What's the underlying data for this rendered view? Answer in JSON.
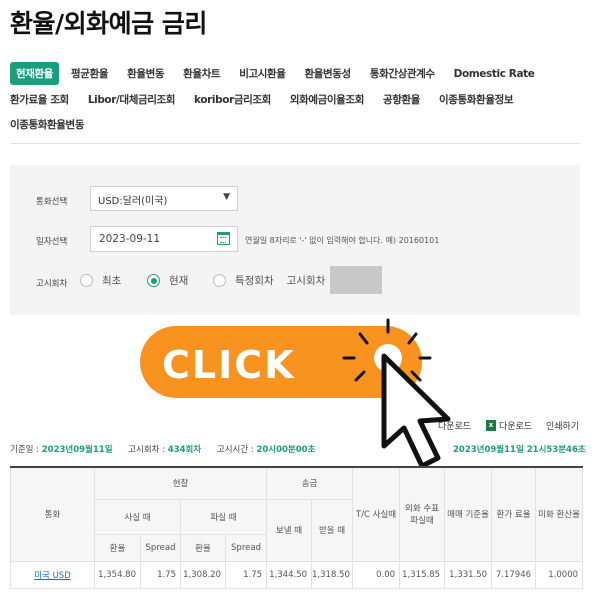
{
  "page": {
    "title": "환율/외화예금 금리"
  },
  "tabs": {
    "row1": [
      "현재환율",
      "평균환율",
      "환율변동",
      "환율차트",
      "비고시환율",
      "환율변동성",
      "통화간상관계수",
      "Domestic Rate"
    ],
    "row2": [
      "환가료율 조회",
      "Libor/대체금리조회",
      "koribor금리조회",
      "외화예금이율조회",
      "공항환율",
      "이종통화환율정보"
    ],
    "row3": [
      "이종통화환율변동"
    ],
    "active": "현재환율"
  },
  "search": {
    "currency_label": "통화선택",
    "currency_value": "USD:달러(미국)",
    "date_label": "일자선택",
    "date_value": "2023-09-11",
    "date_hint": "연월일 8자리로 '-' 없이 입력해야 합니다. 예) 20160101",
    "round_label": "고시회차",
    "round_options": [
      "최초",
      "현재",
      "특정회차"
    ],
    "round_selected": "현재",
    "round_input_label": "고시회차"
  },
  "banner": {
    "text": "CLICK"
  },
  "toolbar": {
    "download1": "다운로드",
    "download2": "다운로드",
    "print": "인쇄하기"
  },
  "info": {
    "base_date_label": "기준일 :",
    "base_date": "2023년09월11일",
    "round_label": "고시회차 :",
    "round": "434회차",
    "time_label": "고시시간 :",
    "time": "20시00분00초",
    "lookup_time": "2023년09월11일 21시53분46초"
  },
  "table": {
    "headers": {
      "currency": "통화",
      "cash": "현찰",
      "remit": "송금",
      "buy": "사실 때",
      "sell": "파실 때",
      "send": "보낼 때",
      "receive": "받을 때",
      "tc": "T/C 사실때",
      "cheque": "외화 수표 파실때",
      "base_rate": "매매 기준율",
      "conv_rate": "환가 료율",
      "usd_rate": "미화 환산율",
      "rate": "환율",
      "spread": "Spread"
    },
    "rows": [
      {
        "currency": "미국 USD",
        "cash_buy": "1,354.80",
        "cash_buy_spread": "1.75",
        "cash_sell": "1,308.20",
        "cash_sell_spread": "1.75",
        "send": "1,344.50",
        "receive": "1,318.50",
        "tc": "0.00",
        "cheque": "1,315.85",
        "base": "1,331.50",
        "conv": "7.17946",
        "usd": "1.0000"
      }
    ]
  },
  "colors": {
    "accent": "#1a9e7e",
    "banner": "#f7931e",
    "link": "#1a6fbf"
  }
}
